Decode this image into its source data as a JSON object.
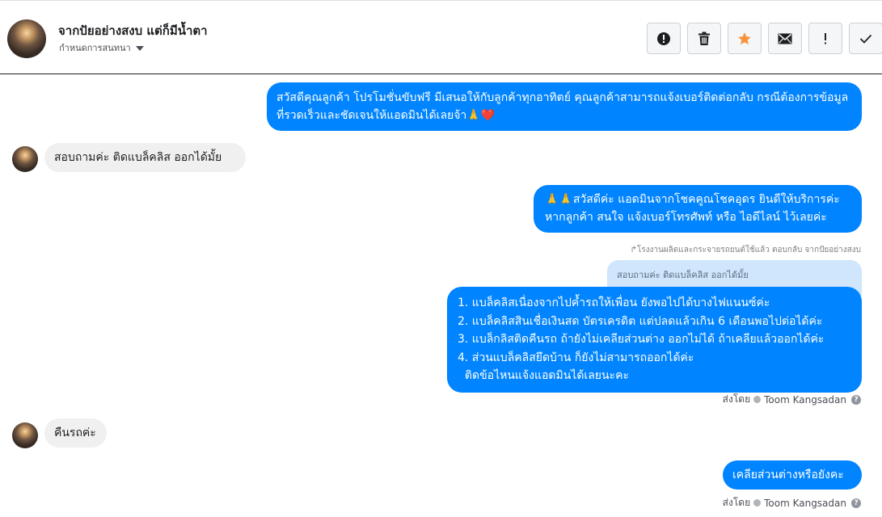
{
  "header": {
    "name": "จากปัยอย่างสงบ แต่ก็มีน้ำตา",
    "subtitle": "กำหนดการสนทนา"
  },
  "icons": [
    "alert-circle-icon",
    "trash-icon",
    "star-icon",
    "envelope-icon",
    "exclamation-icon",
    "check-icon"
  ],
  "accent_colors": {
    "outgoing": "#0084ff",
    "star": "#f7923a"
  },
  "messages": {
    "m1": "สวัสดีคุณลูกค้า โปรโมชั่นขับฟรี มีเสนอให้กับลูกค้าทุกอาทิตย์ คุณลูกค้าสามารถแจ้งเบอร์ติดต่อกลับ กรณีต้องการข้อมูลที่รวดเร็วและชัดเจนให้แอดมินได้เลยจ้า🙏❤️",
    "m2": "สอบถามค่ะ ติดแบล็คลิส ออกได้มั้ย",
    "m3": "🙏🙏สวัสดีค่ะ แอดมินจากโชคคูณโชคอุดร ยินดีให้บริการค่ะ หากลูกค้า สนใจ แจ้งเบอร์โทรศัพท์ หรือ ไอดีไลน์  ไว้เลยค่ะ",
    "reply_note": "↱โรงงานผลิตและกระจายรถยนต์ใช้แล้ว ตอบกลับ จากปัยอย่างสงบ",
    "quoted": "สอบถามค่ะ ติดแบล็คลิส ออกได้มั้ย",
    "m4_lines": [
      "1. แบล็คลิสเนื่องจากไปค้ำรถให้เพื่อน ยังพอไปได้บางไฟแนนซ์ค่ะ",
      "2. แบล็คลิสสินเชื่อเงินสด บัตรเครดิต แต่ปลดแล้วเกิน 6 เดือนพอไปต่อได้ค่ะ",
      "3. แบล็กลิสติดคืนรถ ถ้ายังไม่เคลียส่วนต่าง ออกไม่ได้ ถ้าเคลียแล้วออกได้ค่ะ",
      "4. ส่วนแบล็คลิสยึดบ้าน ก็ยังไม่สามารถออกได้ค่ะ",
      "  ติดข้อไหนแจ้งแอดมินได้เลยนะคะ"
    ],
    "m5": "คืนรถค่ะ",
    "m6": "เคลียส่วนต่างหรือยังคะ"
  },
  "sent_by": {
    "label": "ส่งโดย",
    "name": "Toom Kangsadan",
    "help": "?"
  }
}
